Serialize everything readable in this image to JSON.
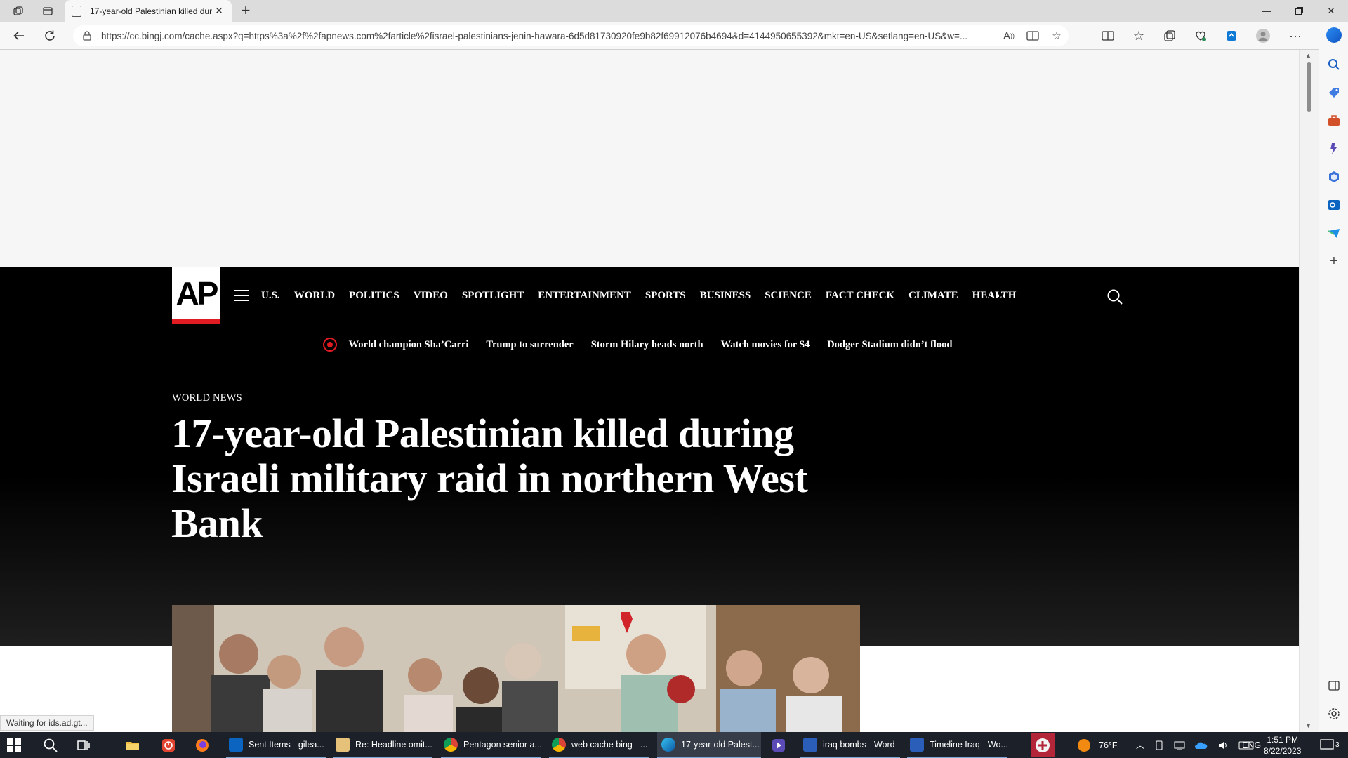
{
  "browser": {
    "tab_title": "17-year-old Palestinian killed dur",
    "url": "https://cc.bingj.com/cache.aspx?q=https%3a%2f%2fapnews.com%2farticle%2fisrael-palestinians-jenin-hawara-6d5d81730920fe9b82f69912076b4694&d=4144950655392&mkt=en-US&setlang=en-US&w=...",
    "status_text": "Waiting for ids.ad.gt..."
  },
  "site": {
    "logo": "AP",
    "nav": [
      "U.S.",
      "WORLD",
      "POLITICS",
      "VIDEO",
      "SPOTLIGHT",
      "ENTERTAINMENT",
      "SPORTS",
      "BUSINESS",
      "SCIENCE",
      "FACT CHECK",
      "CLIMATE",
      "HEALTH"
    ],
    "more": "···",
    "trending": [
      "World champion Sha’Carri",
      "Trump to surrender",
      "Storm Hilary heads north",
      "Watch movies for $4",
      "Dodger Stadium didn’t flood"
    ]
  },
  "article": {
    "kicker": "WORLD NEWS",
    "headline": "17-year-old Palestinian killed during Israeli military raid in northern West Bank"
  },
  "taskbar": {
    "apps": [
      "Sent Items - gilea...",
      "Re: Headline omit...",
      "Pentagon senior a...",
      "web cache bing - ...",
      "17-year-old Palest...",
      "iraq bombs - Word",
      "Timeline Iraq - Wo..."
    ],
    "weather": "76°F",
    "language": "ENG",
    "time": "1:51 PM",
    "date": "8/22/2023",
    "notifications": "3"
  },
  "colors": {
    "ap_red": "#e11b22",
    "hero_bg": "#000000",
    "taskbar_bg": "#1c2129"
  }
}
